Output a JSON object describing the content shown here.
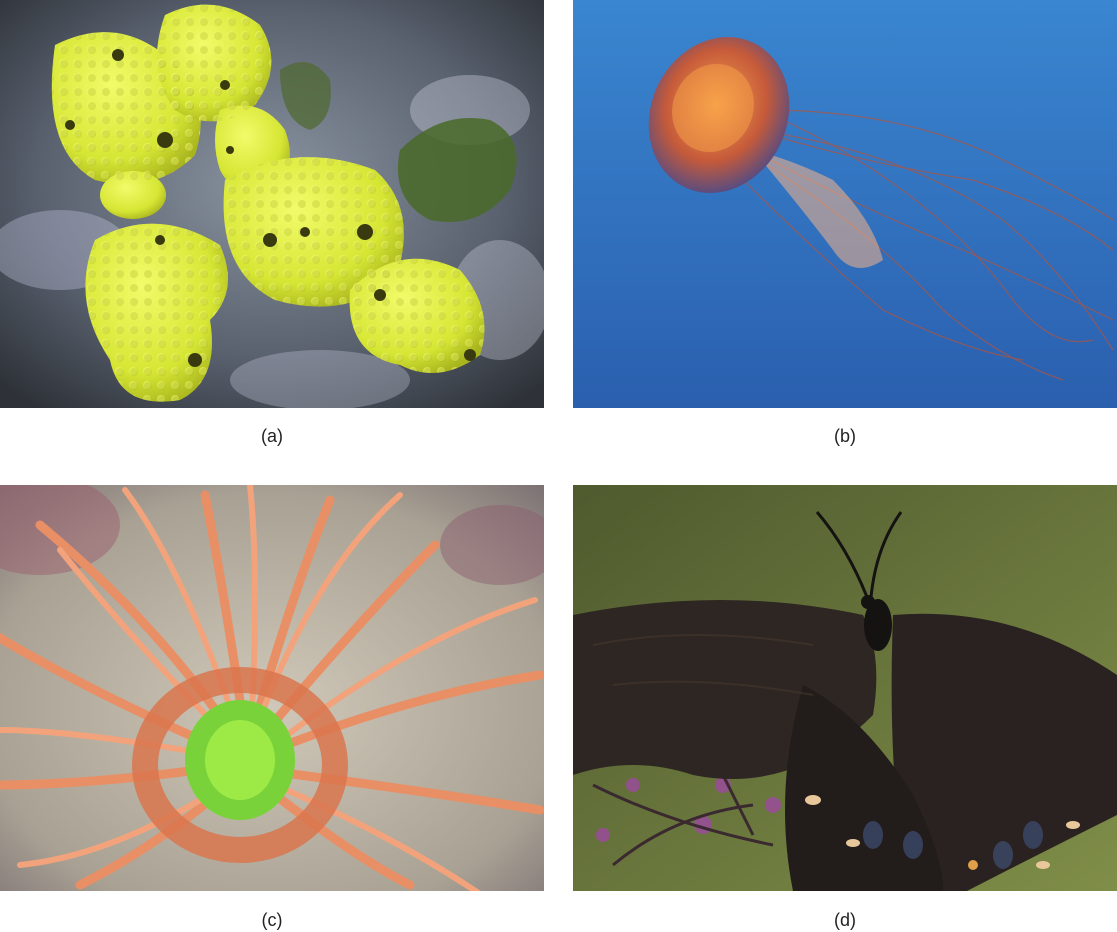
{
  "panels": [
    {
      "caption": "(a)",
      "subject": "yellow-sponge",
      "colors": {
        "main": "#d9ea3a",
        "bg": "#5c6470"
      }
    },
    {
      "caption": "(b)",
      "subject": "jellyfish",
      "colors": {
        "main": "#e0824a",
        "bg": "#2f6fbf"
      }
    },
    {
      "caption": "(c)",
      "subject": "sea-anemone",
      "colors": {
        "main": "#e8936a",
        "bg": "#b9b2a6"
      }
    },
    {
      "caption": "(d)",
      "subject": "butterfly",
      "colors": {
        "main": "#2a2420",
        "bg": "#6b7a3c"
      }
    }
  ]
}
